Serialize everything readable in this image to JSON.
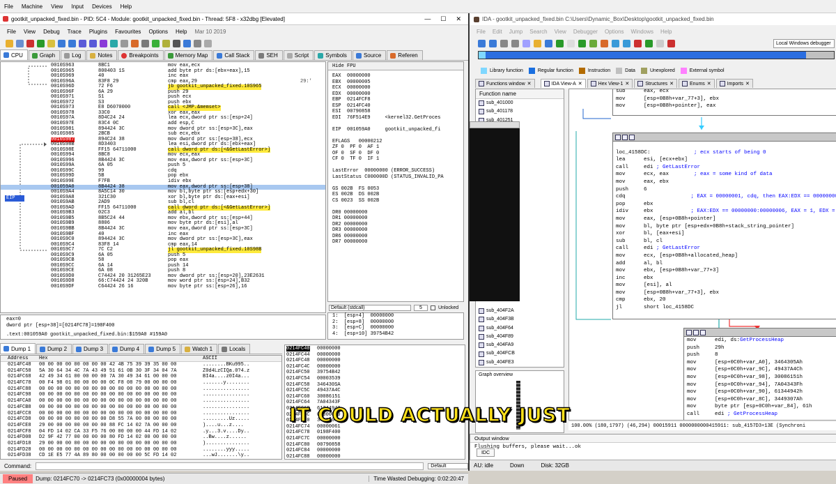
{
  "host_menu": [
    "File",
    "Machine",
    "View",
    "Input",
    "Devices",
    "Help"
  ],
  "x32": {
    "title": "gootkit_unpacked_fixed.bin - PID: 5C4 - Module: gootkit_unpacked_fixed.bin - Thread: 5F8 - x32dbg [Elevated]",
    "menu": [
      "File",
      "View",
      "Debug",
      "Trace",
      "Plugins",
      "Favourites",
      "Options",
      "Help"
    ],
    "date": "Mar 10 2019",
    "tabs": [
      "CPU",
      "Graph",
      "Log",
      "Notes",
      "Breakpoints",
      "Memory Map",
      "Call Stack",
      "SEH",
      "Script",
      "Symbols",
      "Source",
      "Referen"
    ],
    "eip_label": "EIP",
    "disasm": [
      {
        "a": "0010S963",
        "b": "8BC1",
        "i": "mov eax,ecx"
      },
      {
        "a": "0010S965",
        "b": "800403 1S",
        "i": "add byte ptr ds:[ebx+eax],15"
      },
      {
        "a": "0010S969",
        "b": "40",
        "i": "inc eax"
      },
      {
        "a": "0010S96A",
        "b": "83F8 29",
        "i": "cmp eax,29",
        "c": "29:'"
      },
      {
        "a": "0010S96D",
        "b": "72 F6",
        "i": "jb gootkit_unpacked_fixed.10S965",
        "hl": 1
      },
      {
        "a": "0010S96F",
        "b": "6A 29",
        "i": "push 29"
      },
      {
        "a": "0010S971",
        "b": "S1",
        "i": "push ecx"
      },
      {
        "a": "0010S972",
        "b": "S3",
        "i": "push ebx"
      },
      {
        "a": "0010S973",
        "b": "E8 D6070000",
        "i": "call <JMP.&memset>",
        "hl": 1
      },
      {
        "a": "0010S978",
        "b": "33C0",
        "i": "xor eax,eax"
      },
      {
        "a": "0010S97A",
        "b": "8D4C24 24",
        "i": "lea ecx,dword ptr ss:[esp+24]"
      },
      {
        "a": "0010S97E",
        "b": "83C4 0C",
        "i": "add esp,C"
      },
      {
        "a": "0010S981",
        "b": "894424 3C",
        "i": "mov dword ptr ss:[esp+3C],eax"
      },
      {
        "a": "0010S985",
        "b": "2BCB",
        "i": "sub ecx,ebx"
      },
      {
        "a": "0010S987",
        "b": "894C24 38",
        "i": "mov dword ptr ss:[esp+38],ecx",
        "bp": 1
      },
      {
        "a": "0010S98B",
        "b": "8D3403",
        "i": "lea esi,dword ptr ds:[ebx+eax]"
      },
      {
        "a": "0010S98E",
        "b": "FF15 64711000",
        "i": "call dword ptr ds:[<&GetLastError>]",
        "hl": 1
      },
      {
        "a": "0010S994",
        "b": "8BC8",
        "i": "mov ecx,eax"
      },
      {
        "a": "0010S996",
        "b": "8B4424 3C",
        "i": "mov eax,dword ptr ss:[esp+3C]"
      },
      {
        "a": "0010S99A",
        "b": "6A 05",
        "i": "push 5"
      },
      {
        "a": "0010S99C",
        "b": "99",
        "i": "cdq"
      },
      {
        "a": "0010S99D",
        "b": "5B",
        "i": "pop ebx"
      },
      {
        "a": "0010S99E",
        "b": "F7FB",
        "i": "idiv ebx"
      },
      {
        "a": "001059A0",
        "b": "8B4424 38",
        "i": "mov eax,dword ptr ss:[esp+38]",
        "eip": 1
      },
      {
        "a": "0010S9A4",
        "b": "8A5C14 30",
        "i": "mov bl,byte ptr ss:[esp+edx+30]"
      },
      {
        "a": "0010S9A8",
        "b": "321C30",
        "i": "xor bl,byte ptr ds:[eax+esi]"
      },
      {
        "a": "0010S9AB",
        "b": "2AD9",
        "i": "sub bl,cl"
      },
      {
        "a": "0010S9AD",
        "b": "FF15 64711000",
        "i": "call dword ptr ds:[<&GetLastError>]",
        "hl": 1
      },
      {
        "a": "0010S9B3",
        "b": "02C3",
        "i": "add al,bl"
      },
      {
        "a": "0010S9B5",
        "b": "8B5C24 44",
        "i": "mov ebx,dword ptr ss:[esp+44]"
      },
      {
        "a": "0010S9B9",
        "b": "8806",
        "i": "mov byte ptr ds:[esi],al"
      },
      {
        "a": "0010S9BB",
        "b": "8B4424 3C",
        "i": "mov eax,dword ptr ss:[esp+3C]"
      },
      {
        "a": "0010S9BF",
        "b": "40",
        "i": "inc eax"
      },
      {
        "a": "0010S9C0",
        "b": "894424 3C",
        "i": "mov dword ptr ss:[esp+3C],eax"
      },
      {
        "a": "0010S9C4",
        "b": "83F8 14",
        "i": "cmp eax,14"
      },
      {
        "a": "0010S9C7",
        "b": "7C C2",
        "i": "jl gootkit_unpacked_fixed.10S98B",
        "hl": 1
      },
      {
        "a": "0010S9C9",
        "b": "6A 05",
        "i": "push 5"
      },
      {
        "a": "0010S9CB",
        "b": "58",
        "i": "pop eax"
      },
      {
        "a": "0010S9CC",
        "b": "6A 14",
        "i": "push 14"
      },
      {
        "a": "0010S9CE",
        "b": "6A 08",
        "i": "push 8"
      },
      {
        "a": "0010S9D0",
        "b": "C74424 20 31265E23",
        "i": "mov dword ptr ss:[esp+20],23E2631"
      },
      {
        "a": "0010S9D8",
        "b": "66:C74424 24 320B",
        "i": "mov word ptr ss:[esp+24],B32"
      },
      {
        "a": "0010S9DF",
        "b": "C64424 26 16",
        "i": "mov byte ptr ss:[esp+26],16"
      }
    ],
    "reg_tabs": [
      "Hide FPU"
    ],
    "registers": [
      "EAX  00000000",
      "EBX  00000005",
      "ECX  00000000",
      "EDX  00000000",
      "EBP  0214FCF8",
      "ESP  0214FC40",
      "ESI  00790858",
      "EDI  76F514E9     <kernel32.GetProces",
      "",
      "EIP  001059A0     gootkit_unpacked_fi",
      "",
      "EFLAGS   00000212",
      "ZF 0  PF 0  AF 1",
      "OF 0  SF 0  DF 0",
      "CF 0  TF 0  IF 1",
      "",
      "LastError  00000000 (ERROR_SUCCESS)",
      "LastStatus C000000D (STATUS_INVALID_PA",
      "",
      "GS 002B  FS 0053",
      "ES 002B  DS 002B",
      "CS 0023  SS 002B",
      "",
      "DR0 00000000",
      "DR1 00000000",
      "DR2 00000000",
      "DR3 00000000",
      "DR6 00000000",
      "DR7 00000000"
    ],
    "callconv": "Default (stdcall)",
    "callconv_n": "5",
    "unlocked": "Unlocked",
    "stack_args": [
      "1:  [esp+4]  00000000",
      "2:  [esp+8]  00000000",
      "3:  [esp+C]  00000000",
      "4:  [esp+10] 39754B42"
    ],
    "info_lines": [
      "eax=0",
      "dword ptr [esp+38]=[0214FC78]=198F400",
      "",
      ".text:001059A0 gootkit_unpacked_fixed.bin:$159A0 #159A0"
    ],
    "dump_tabs": [
      "Dump 1",
      "Dump 2",
      "Dump 3",
      "Dump 4",
      "Dump 5",
      "Watch 1",
      "Locals"
    ],
    "dump_hdr": {
      "addr": "Address",
      "hex": "Hex",
      "ascii": "ASCII"
    },
    "dump": [
      {
        "a": "0214FC48",
        "h": "00 00 00 00 00 00 00 00 42 4B 75 39 39 35 00 00",
        "s": "........BKu995.."
      },
      {
        "a": "0214FC58",
        "h": "5A 30 64 34 4C 7A 43 49 51 61 0B 30 3F 34 04 7A",
        "s": "Z0d4LzCIQa.0?4.z"
      },
      {
        "a": "0214FC68",
        "h": "42 49 34 61 00 00 00 00 7A 30 49 34 61 00 00 00",
        "s": "BI4a....z0I4a..."
      },
      {
        "a": "0214FC78",
        "h": "00 F4 98 01 00 00 00 00 0C F8 08 79 00 00 00 00",
        "s": ".......y........"
      },
      {
        "a": "0214FC88",
        "h": "00 00 00 00 00 00 00 00 00 00 00 00 00 00 00 00",
        "s": "................"
      },
      {
        "a": "0214FC98",
        "h": "00 00 00 00 00 00 00 00 00 00 00 00 00 00 00 00",
        "s": "................"
      },
      {
        "a": "0214FCA8",
        "h": "00 00 00 00 00 00 00 00 00 00 00 00 00 00 00 00",
        "s": "................"
      },
      {
        "a": "0214FCB8",
        "h": "00 00 00 00 00 00 00 00 00 00 00 00 00 00 00 00",
        "s": "................"
      },
      {
        "a": "0214FCC8",
        "h": "00 00 00 00 00 00 00 00 00 00 00 00 00 00 00 00",
        "s": "................"
      },
      {
        "a": "0214FCD8",
        "h": "00 00 00 00 00 00 00 00 D8 55 7A 00 00 00 00 00",
        "s": ".........Uz....."
      },
      {
        "a": "0214FCE8",
        "h": "29 00 00 00 00 00 00 00 88 FC 14 02 7A 00 00 00",
        "s": ")....u...z...."
      },
      {
        "a": "0214FCF8",
        "h": "04 FD 14 02 CA 33 F5 76 00 00 00 00 44 FD 14 02",
        "s": ".y...3.v....Dy.."
      },
      {
        "a": "0214FD08",
        "h": "D2 9F 42 77 00 00 00 00 80 FD 14 02 00 00 00 00",
        "s": "..Bw....z......"
      },
      {
        "a": "0214FD18",
        "h": "29 00 00 00 00 00 00 00 00 00 00 00 00 00 00 00",
        "s": ")..............."
      },
      {
        "a": "0214FD28",
        "h": "00 00 00 00 00 00 00 00 00 00 00 00 00 00 00 00",
        "s": "........yyy....."
      },
      {
        "a": "0214FD38",
        "h": "CD 1E E5 77 4A 89 80 00 00 00 00 00 5C FD 14 02",
        "s": "...wJ.......\\y.."
      }
    ],
    "stack": [
      {
        "a": "0214FC40",
        "v": "00000000"
      },
      {
        "a": "0214FC44",
        "v": "00000000"
      },
      {
        "a": "0214FC48",
        "v": "00000000"
      },
      {
        "a": "0214FC4C",
        "v": "00000000"
      },
      {
        "a": "0214FC50",
        "v": "39754B42"
      },
      {
        "a": "0214FC54",
        "v": "00003539"
      },
      {
        "a": "0214FC58",
        "v": "346430SA"
      },
      {
        "a": "0214FC5C",
        "v": "49437A4C"
      },
      {
        "a": "0214FC60",
        "v": "30086151"
      },
      {
        "a": "0214FC64",
        "v": "7A04343F"
      },
      {
        "a": "0214FC68",
        "v": "61344942"
      },
      {
        "a": "0214FC6C",
        "v": "00000000"
      },
      {
        "a": "0214FC70",
        "v": "3449307A"
      },
      {
        "a": "0214FC74",
        "v": "00000061"
      },
      {
        "a": "0214FC78",
        "v": "0198F400"
      },
      {
        "a": "0214FC7C",
        "v": "00000000"
      },
      {
        "a": "0214FC80",
        "v": "00790858"
      },
      {
        "a": "0214FC84",
        "v": "00000000"
      },
      {
        "a": "0214FC88",
        "v": "00000000"
      }
    ],
    "command_label": "Command:",
    "command_sel": "Default",
    "status_paused": "Paused",
    "status_dump": "Dump: 0214FC70 -> 0214FC73 (0x00000004 bytes)",
    "status_time": "Time Wasted Debugging: 0:02:20:47"
  },
  "ida": {
    "title": "IDA - gootkit_unpacked_fixed.bin C:\\Users\\Dynamic_Box\\Desktop\\gootkit_unpacked_fixed.bin",
    "menu": [
      "File",
      "Edit",
      "Jump",
      "Search",
      "View",
      "Debugger",
      "Options",
      "Windows",
      "Help"
    ],
    "debugger": "Local Windows debugger",
    "legend": [
      {
        "label": "Library function",
        "color": "#7fd7ff"
      },
      {
        "label": "Regular function",
        "color": "#1a6fe0"
      },
      {
        "label": "Instruction",
        "color": "#b36b00"
      },
      {
        "label": "Data",
        "color": "#c0c0c0"
      },
      {
        "label": "Unexplored",
        "color": "#a0a060"
      },
      {
        "label": "External symbol",
        "color": "#ff80ff"
      }
    ],
    "tabs": [
      "Functions window",
      "IDA View-A",
      "Hex View-1",
      "Structures",
      "Enums",
      "Imports"
    ],
    "func_header": "Function name",
    "functions_top": [
      "sub_401000",
      "sub_401178",
      "sub_401251"
    ],
    "functions_bottom": [
      "sub_404F2A",
      "sub_404F3B",
      "sub_404F64",
      "sub_404F89",
      "sub_404FA9",
      "sub_404FCB",
      "sub_404FE3"
    ],
    "graph_overview": "Graph overview",
    "top_node": [
      {
        "m": "sub",
        "o": "eax, ecx"
      },
      {
        "m": "mov",
        "o": "[esp+0B8h+var_77+3], ebx"
      },
      {
        "m": "mov",
        "o": "[esp+0B8h+pointer], eax"
      }
    ],
    "main_node": [
      {
        "m": "",
        "o": "",
        "cm": ""
      },
      {
        "m": "loc_4158DC:",
        "o": "                ",
        "cm": "; ecx starts of being 0"
      },
      {
        "m": "lea",
        "o": "esi, [ecx+ebx]",
        "cm": ""
      },
      {
        "m": "call",
        "o": "edi ",
        "sym": "; GetLastError"
      },
      {
        "m": "mov",
        "o": "ecx, eax",
        "cm": "        ; eax = some kind of data"
      },
      {
        "m": "mov",
        "o": "eax, ebx",
        "cm": ""
      },
      {
        "m": "push",
        "o": "6",
        "cm": ""
      },
      {
        "m": "cdq",
        "o": "",
        "cm": "               ; EAX = 00000001, cdq, then EAX:EDX == 00000000:"
      },
      {
        "m": "pop",
        "o": "ebx",
        "cm": ""
      },
      {
        "m": "idiv",
        "o": "ebx",
        "cm": "            ; EAX:EDX == 00000000:00000006, EAX = 1, EDX = 0"
      },
      {
        "m": "mov",
        "o": "eax, [esp+0B8h+pointer]",
        "cm": ""
      },
      {
        "m": "mov",
        "o": "bl, byte ptr [esp+edx+0B8h+stack_string_pointer]",
        "cm": ""
      },
      {
        "m": "xor",
        "o": "bl, [eax+esi]",
        "cm": ""
      },
      {
        "m": "sub",
        "o": "bl, cl",
        "cm": ""
      },
      {
        "m": "call",
        "o": "edi ",
        "sym": "; GetLastError"
      },
      {
        "m": "mov",
        "o": "ecx, [esp+0B8h+allocated_heap]",
        "cm": ""
      },
      {
        "m": "add",
        "o": "al, bl",
        "cm": ""
      },
      {
        "m": "mov",
        "o": "ebx, [esp+0B8h+var_77+3]",
        "cm": ""
      },
      {
        "m": "inc",
        "o": "ebx",
        "cm": ""
      },
      {
        "m": "mov",
        "o": "[esi], al",
        "cm": ""
      },
      {
        "m": "mov",
        "o": "[esp+0B8h+var_77+3], ebx",
        "cm": ""
      },
      {
        "m": "cmp",
        "o": "ebx, 20",
        "cm": ""
      },
      {
        "m": "jl",
        "o": "short loc_4158DC",
        "cm": ""
      }
    ],
    "bottom_node": [
      {
        "m": "mov",
        "o": "edi, ds:",
        "sym": "GetProcessHeap"
      },
      {
        "m": "push",
        "o": "29h"
      },
      {
        "m": "push",
        "o": "8"
      },
      {
        "m": "mov",
        "o": "[esp+0C0h+var_A0], 3464305Ah"
      },
      {
        "m": "mov",
        "o": "[esp+0C0h+var_9C], 49437A4Ch"
      },
      {
        "m": "mov",
        "o": "[esp+0C0h+var_98], 30086151h"
      },
      {
        "m": "mov",
        "o": "[esp+0C0h+var_94], 7A04343Fh"
      },
      {
        "m": "mov",
        "o": "[esp+0C0h+var_90], 61344942h"
      },
      {
        "m": "mov",
        "o": "[esp+0C0h+var_8C], 3449307Ah"
      },
      {
        "m": "mov",
        "o": "byte ptr [esp+0C0h+var_84], 61h"
      },
      {
        "m": "call",
        "o": "edi ",
        "sym": "; GetProcessHeap"
      }
    ],
    "view_status": "100.00% (180,1797) (46,294) 00015911 0000000000415911: sub_4157D3+13E (Synchroni",
    "output_title": "Output window",
    "output_text": "Flushing buffers, please wait...ok",
    "idc": "IDC",
    "au": "AU:  idle",
    "down": "Down",
    "disk": "Disk: 32GB"
  },
  "caption": "IT COULD ACTUALLY JUST"
}
